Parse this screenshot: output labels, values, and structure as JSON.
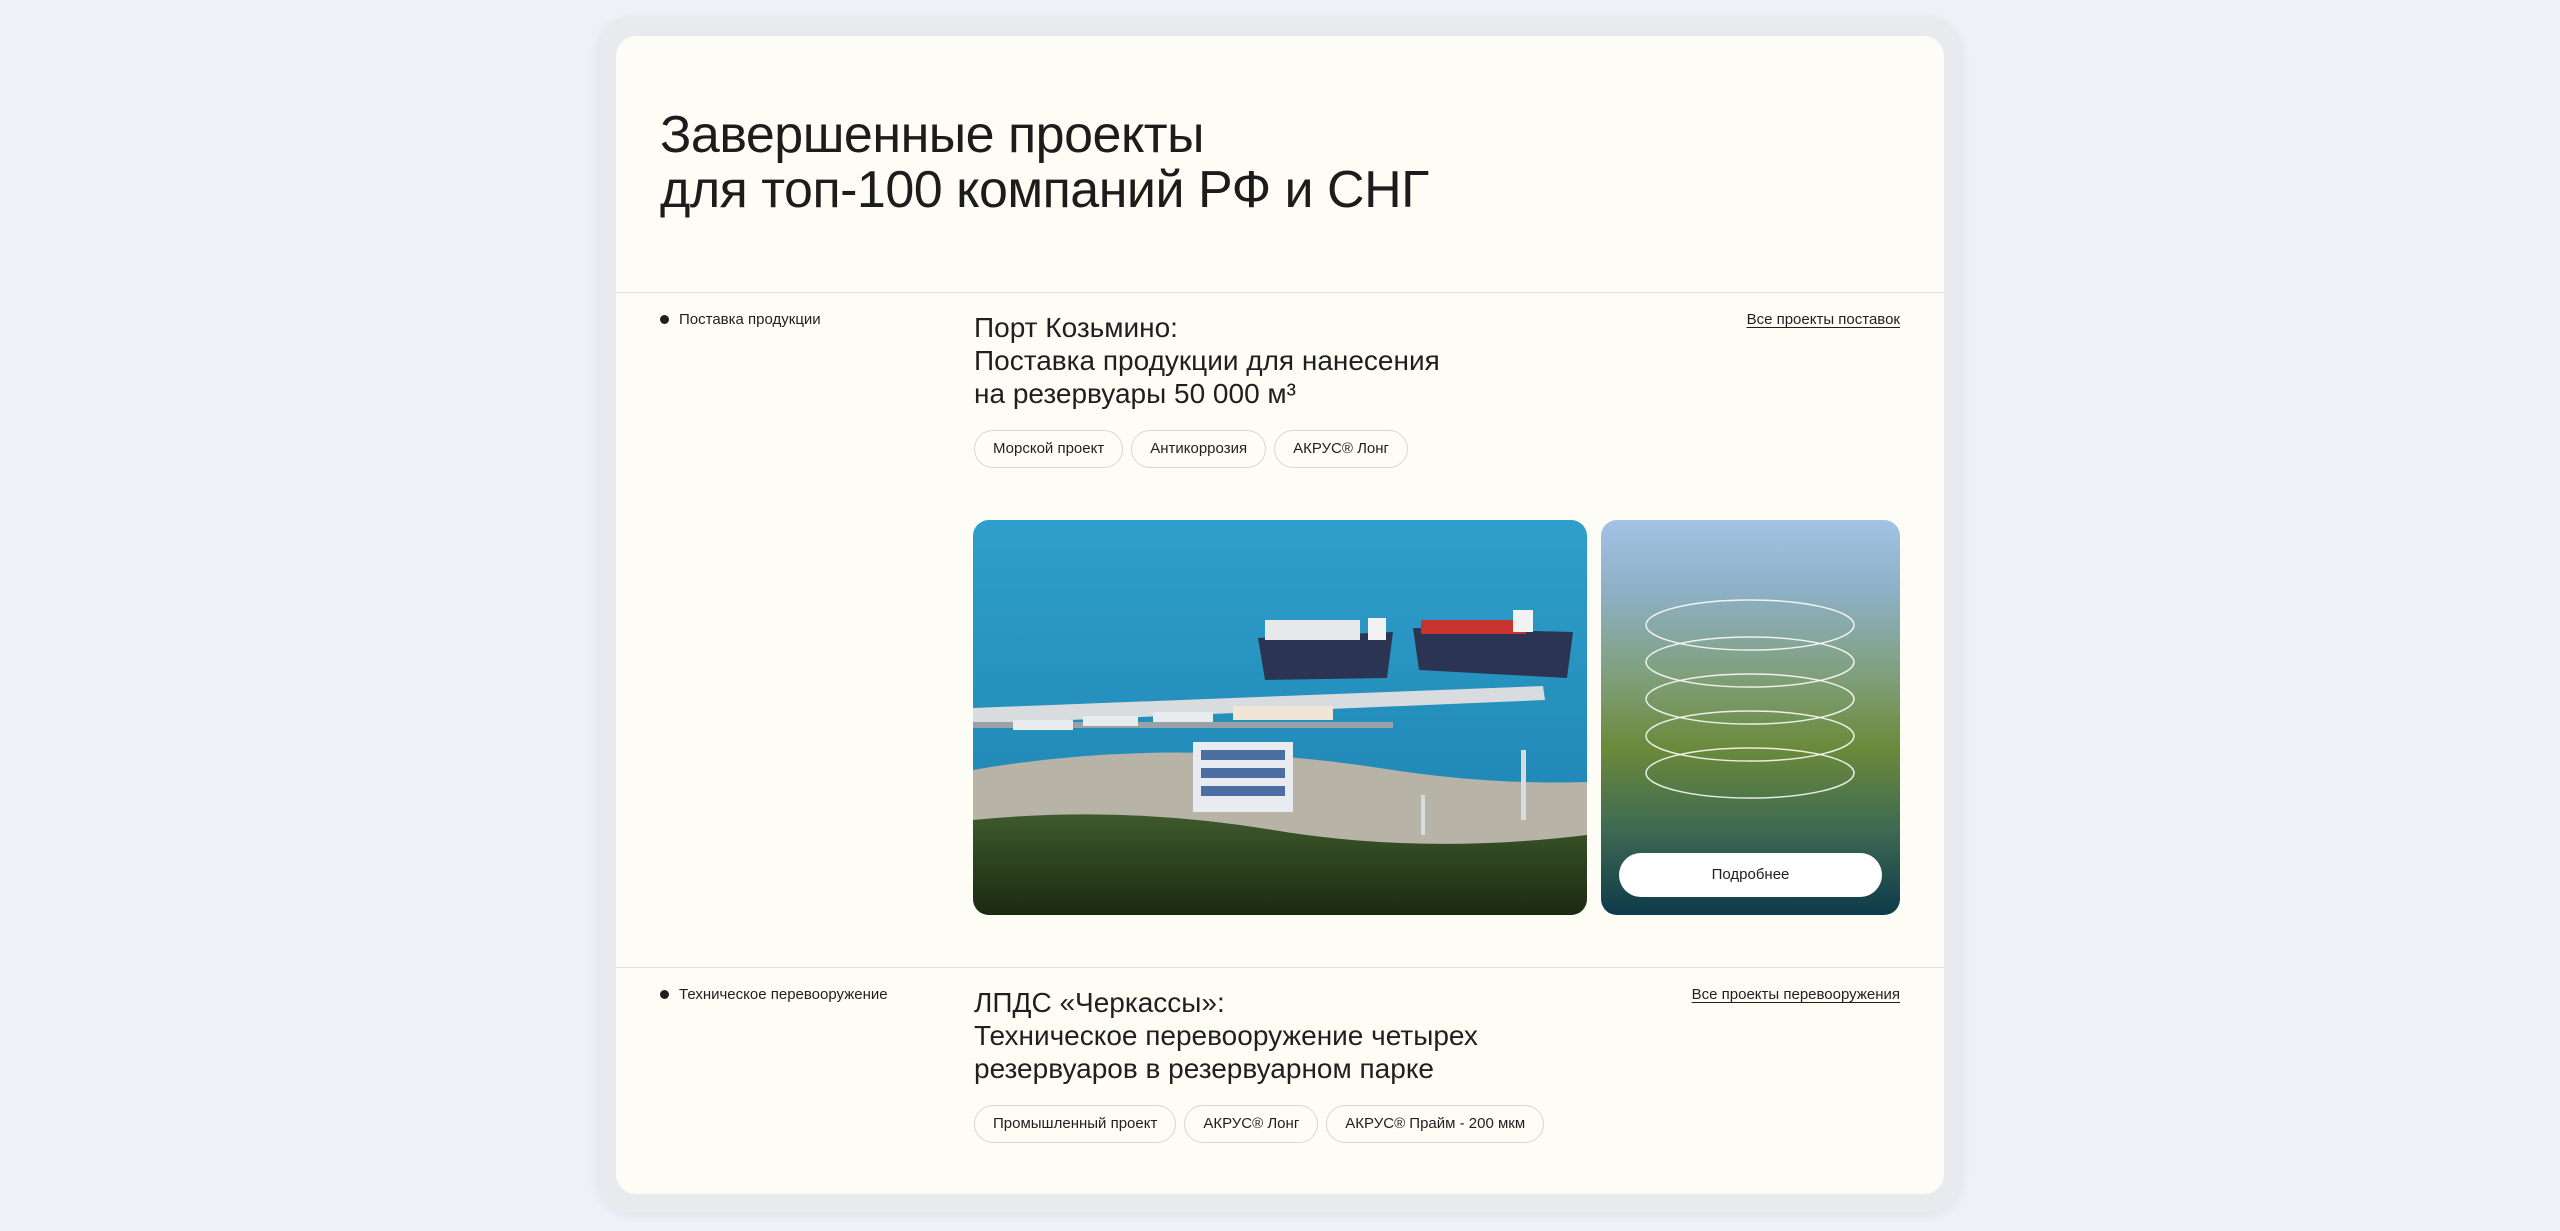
{
  "headline": {
    "line1": "Завершенные проекты",
    "line2": "для топ-100 компаний РФ и СНГ"
  },
  "projects": [
    {
      "category": "Поставка продукции",
      "title_line1": "Порт Козьмино:",
      "title_line2": "Поставка продукции для нанесения",
      "title_line3": "на резервуары 50 000 м³",
      "link": "Все проекты поставок",
      "tags": [
        "Морской проект",
        "Антикоррозия",
        "АКРУС® Лонг"
      ],
      "more_button": "Подробнее"
    },
    {
      "category": "Техническое перевооружение",
      "title_line1": "ЛПДС «Черкассы»:",
      "title_line2": "Техническое перевооружение четырех",
      "title_line3": "резервуаров в резервуарном парке",
      "link": "Все проекты перевооружения",
      "tags": [
        "Промышленный проект",
        "АКРУС® Лонг",
        "АКРУС® Прайм - 200 мкм"
      ]
    }
  ],
  "colors": {
    "page_bg": "#eef1f8",
    "card_bg": "#fefdf5",
    "text": "#1f1f1f",
    "sea": "#2f9cc6"
  }
}
